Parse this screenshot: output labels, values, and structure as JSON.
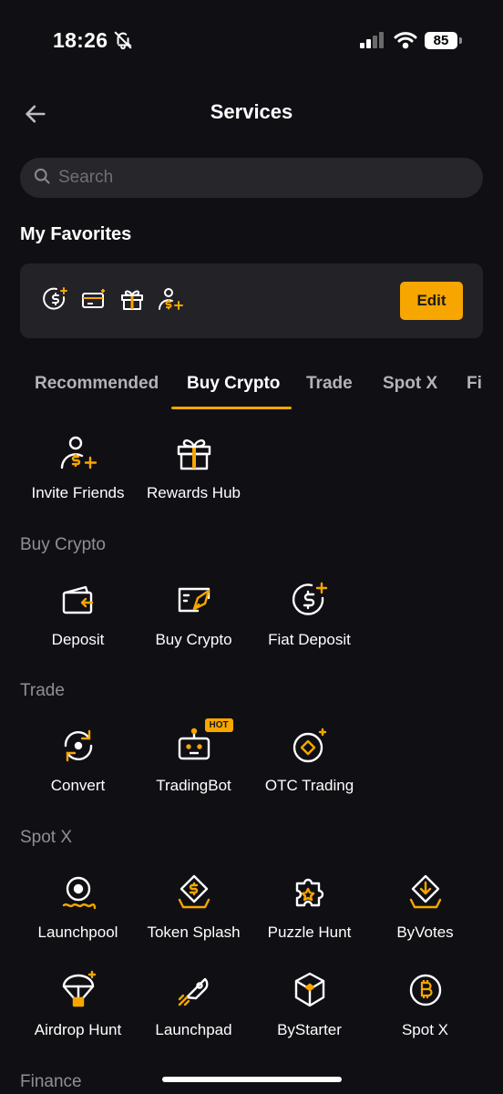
{
  "status": {
    "time": "18:26",
    "battery": "85"
  },
  "header": {
    "title": "Services"
  },
  "search": {
    "placeholder": "Search"
  },
  "favorites": {
    "title": "My Favorites",
    "edit_label": "Edit",
    "icons": [
      "fiat-deposit-icon",
      "card-icon",
      "gift-icon",
      "invite-user-icon"
    ]
  },
  "tabs": [
    {
      "label": "Recommended",
      "active": false
    },
    {
      "label": "Buy Crypto",
      "active": true
    },
    {
      "label": "Trade",
      "active": false
    },
    {
      "label": "Spot X",
      "active": false
    },
    {
      "label": "Fi",
      "active": false
    }
  ],
  "recommended": [
    {
      "label": "Invite Friends",
      "icon": "invite-user-icon"
    },
    {
      "label": "Rewards Hub",
      "icon": "gift-icon"
    }
  ],
  "sections": [
    {
      "title": "Buy Crypto",
      "items": [
        {
          "label": "Deposit",
          "icon": "wallet-deposit-icon"
        },
        {
          "label": "Buy Crypto",
          "icon": "card-rocket-icon"
        },
        {
          "label": "Fiat Deposit",
          "icon": "dollar-plus-icon"
        }
      ]
    },
    {
      "title": "Trade",
      "items": [
        {
          "label": "Convert",
          "icon": "convert-icon"
        },
        {
          "label": "TradingBot",
          "icon": "robot-icon",
          "badge": "HOT"
        },
        {
          "label": "OTC Trading",
          "icon": "otc-icon"
        }
      ]
    },
    {
      "title": "Spot X",
      "items": [
        {
          "label": "Launchpool",
          "icon": "launchpool-icon"
        },
        {
          "label": "Token Splash",
          "icon": "token-splash-icon"
        },
        {
          "label": "Puzzle Hunt",
          "icon": "puzzle-icon"
        },
        {
          "label": "ByVotes",
          "icon": "vote-icon"
        },
        {
          "label": "Airdrop Hunt",
          "icon": "parachute-icon"
        },
        {
          "label": "Launchpad",
          "icon": "rocket-icon"
        },
        {
          "label": "ByStarter",
          "icon": "cube-icon"
        },
        {
          "label": "Spot X",
          "icon": "bitcoin-icon"
        }
      ]
    },
    {
      "title": "Finance",
      "items": []
    }
  ],
  "colors": {
    "accent": "#f7a600",
    "background": "#101014",
    "surface": "#222227"
  }
}
